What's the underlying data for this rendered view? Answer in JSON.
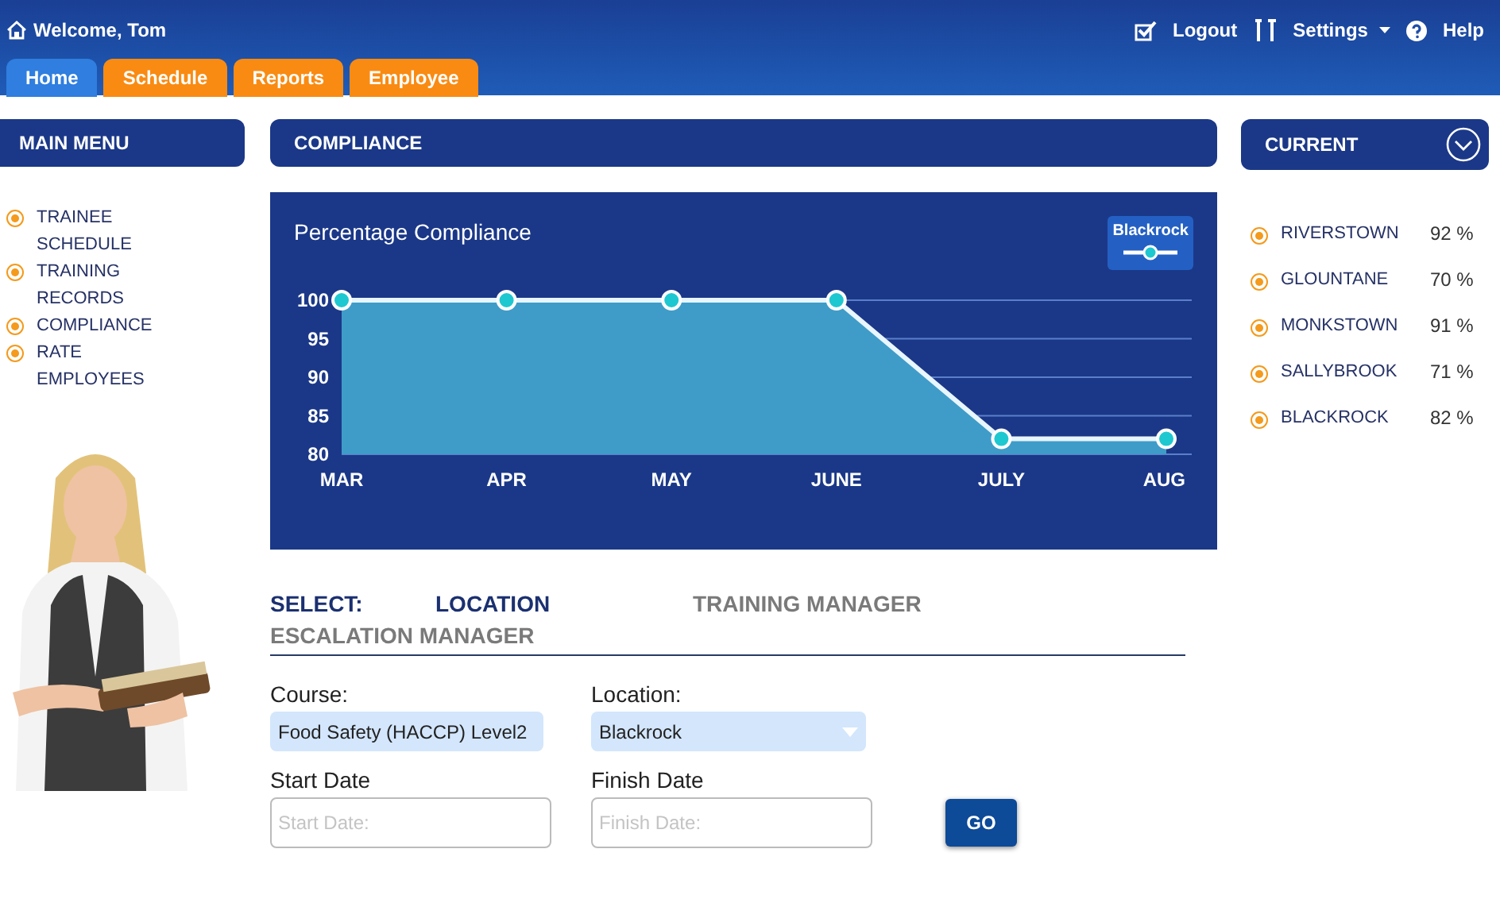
{
  "header": {
    "welcome": "Welcome, Tom",
    "links": [
      {
        "kind": "logout",
        "label": "Logout"
      },
      {
        "kind": "settings",
        "label": "Settings"
      },
      {
        "kind": "help",
        "label": "Help"
      }
    ]
  },
  "tabs": [
    {
      "label": "Home",
      "selected": true
    },
    {
      "label": "Schedule",
      "selected": false
    },
    {
      "label": "Reports",
      "selected": false
    },
    {
      "label": "Employee",
      "selected": false
    }
  ],
  "main_menu": {
    "title": "MAIN MENU",
    "items": [
      "TRAINEE SCHEDULE",
      "TRAINING RECORDS",
      "COMPLIANCE",
      "RATE EMPLOYEES"
    ],
    "photo": {
      "kind": "picture"
    }
  },
  "compliance": {
    "title": "COMPLIANCE",
    "chart_data": {
      "type": "area",
      "title": "Percentage Compliance",
      "categories": [
        "MAR",
        "APR",
        "MAY",
        "JUNE",
        "JULY",
        "AUG"
      ],
      "series": [
        {
          "name": "Blackrock",
          "color": "#1ec8d0",
          "values": [
            100,
            100,
            100,
            100,
            82,
            82
          ]
        }
      ],
      "ylim": [
        80,
        100
      ],
      "grid": true,
      "yticks": [
        80,
        85,
        90,
        95,
        100
      ]
    },
    "select_label": "SELECT:",
    "select_tabs": [
      {
        "label": "LOCATION",
        "selected": true
      },
      {
        "label": "TRAINING MANAGER",
        "selected": false
      },
      {
        "label": "ESCALATION MANAGER",
        "selected": false
      }
    ],
    "course": {
      "label": "Course:",
      "value": "Food Safety (HACCP) Level2"
    },
    "location": {
      "label": "Location:",
      "value": "Blackrock"
    },
    "start_date": {
      "label": "Start Date",
      "placeholder": "Start Date:"
    },
    "finish_date": {
      "label": "Finish Date",
      "placeholder": "Finish Date:"
    },
    "go_button": "GO"
  },
  "current": {
    "title": "CURRENT",
    "items": [
      {
        "name": "RIVERSTOWN",
        "value": "92 %"
      },
      {
        "name": "GLOUNTANE",
        "value": "70 %"
      },
      {
        "name": "MONKSTOWN",
        "value": "91 %"
      },
      {
        "name": "SALLYBROOK",
        "value": "71 %"
      },
      {
        "name": "BLACKROCK",
        "value": "82 %"
      }
    ]
  }
}
